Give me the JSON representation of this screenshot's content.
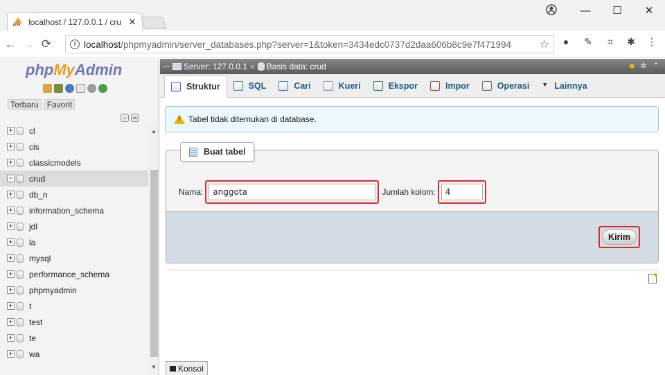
{
  "browser": {
    "tab_title": "localhost / 127.0.0.1 / cru",
    "tab_close": "✕",
    "favicon_label": "pma",
    "url_host": "localhost",
    "url_rest": "/phpmyadmin/server_databases.php?server=1&token=3434edc0737d2daa606b8c9e7f471994",
    "controls": {
      "minimize": "—",
      "maximize": "☐",
      "close": "✕"
    }
  },
  "sidebar": {
    "logo_php": "php",
    "logo_my": "My",
    "logo_admin": "Admin",
    "links": {
      "recent": "Terbaru",
      "favorites": "Favorit"
    },
    "databases": [
      {
        "name": "cl",
        "expanded": false
      },
      {
        "name": "cis",
        "expanded": false
      },
      {
        "name": "classicmodels",
        "expanded": false
      },
      {
        "name": "crud",
        "expanded": true,
        "active": true
      },
      {
        "name": "db_n",
        "expanded": false
      },
      {
        "name": "information_schema",
        "expanded": false
      },
      {
        "name": "jdl",
        "expanded": false
      },
      {
        "name": "la",
        "expanded": false
      },
      {
        "name": "mysql",
        "expanded": false
      },
      {
        "name": "performance_schema",
        "expanded": false
      },
      {
        "name": "phpmyadmin",
        "expanded": false
      },
      {
        "name": "t",
        "expanded": false
      },
      {
        "name": "test",
        "expanded": false
      },
      {
        "name": "te",
        "expanded": false
      },
      {
        "name": "wa",
        "expanded": false
      }
    ]
  },
  "breadcrumb": {
    "server": "Server: 127.0.0.1",
    "separator": "»",
    "database": "Basis data: crud"
  },
  "tabs": [
    {
      "id": "struktur",
      "label": "Struktur",
      "icon": "structure-icon",
      "active": true
    },
    {
      "id": "sql",
      "label": "SQL",
      "icon": "sql-icon"
    },
    {
      "id": "cari",
      "label": "Cari",
      "icon": "search-icon"
    },
    {
      "id": "kueri",
      "label": "Kueri",
      "icon": "query-icon"
    },
    {
      "id": "ekspor",
      "label": "Ekspor",
      "icon": "export-icon"
    },
    {
      "id": "impor",
      "label": "Impor",
      "icon": "import-icon"
    },
    {
      "id": "operasi",
      "label": "Operasi",
      "icon": "wrench-icon"
    },
    {
      "id": "lainnya",
      "label": "Lainnya",
      "icon": "chevron-down-icon"
    }
  ],
  "notice": {
    "text": "Tabel tidak ditemukan di database."
  },
  "create_table": {
    "legend": "Buat tabel",
    "name_label": "Nama:",
    "name_value": "anggota",
    "columns_label": "Jumlah kolom:",
    "columns_value": "4",
    "submit_label": "Kirim"
  },
  "console": {
    "label": "Konsol"
  },
  "colors": {
    "accent_blue": "#235a81",
    "logo_orange": "#f29c1f",
    "highlight_red": "#d92b2b",
    "notice_bg": "#ebf8fd"
  }
}
